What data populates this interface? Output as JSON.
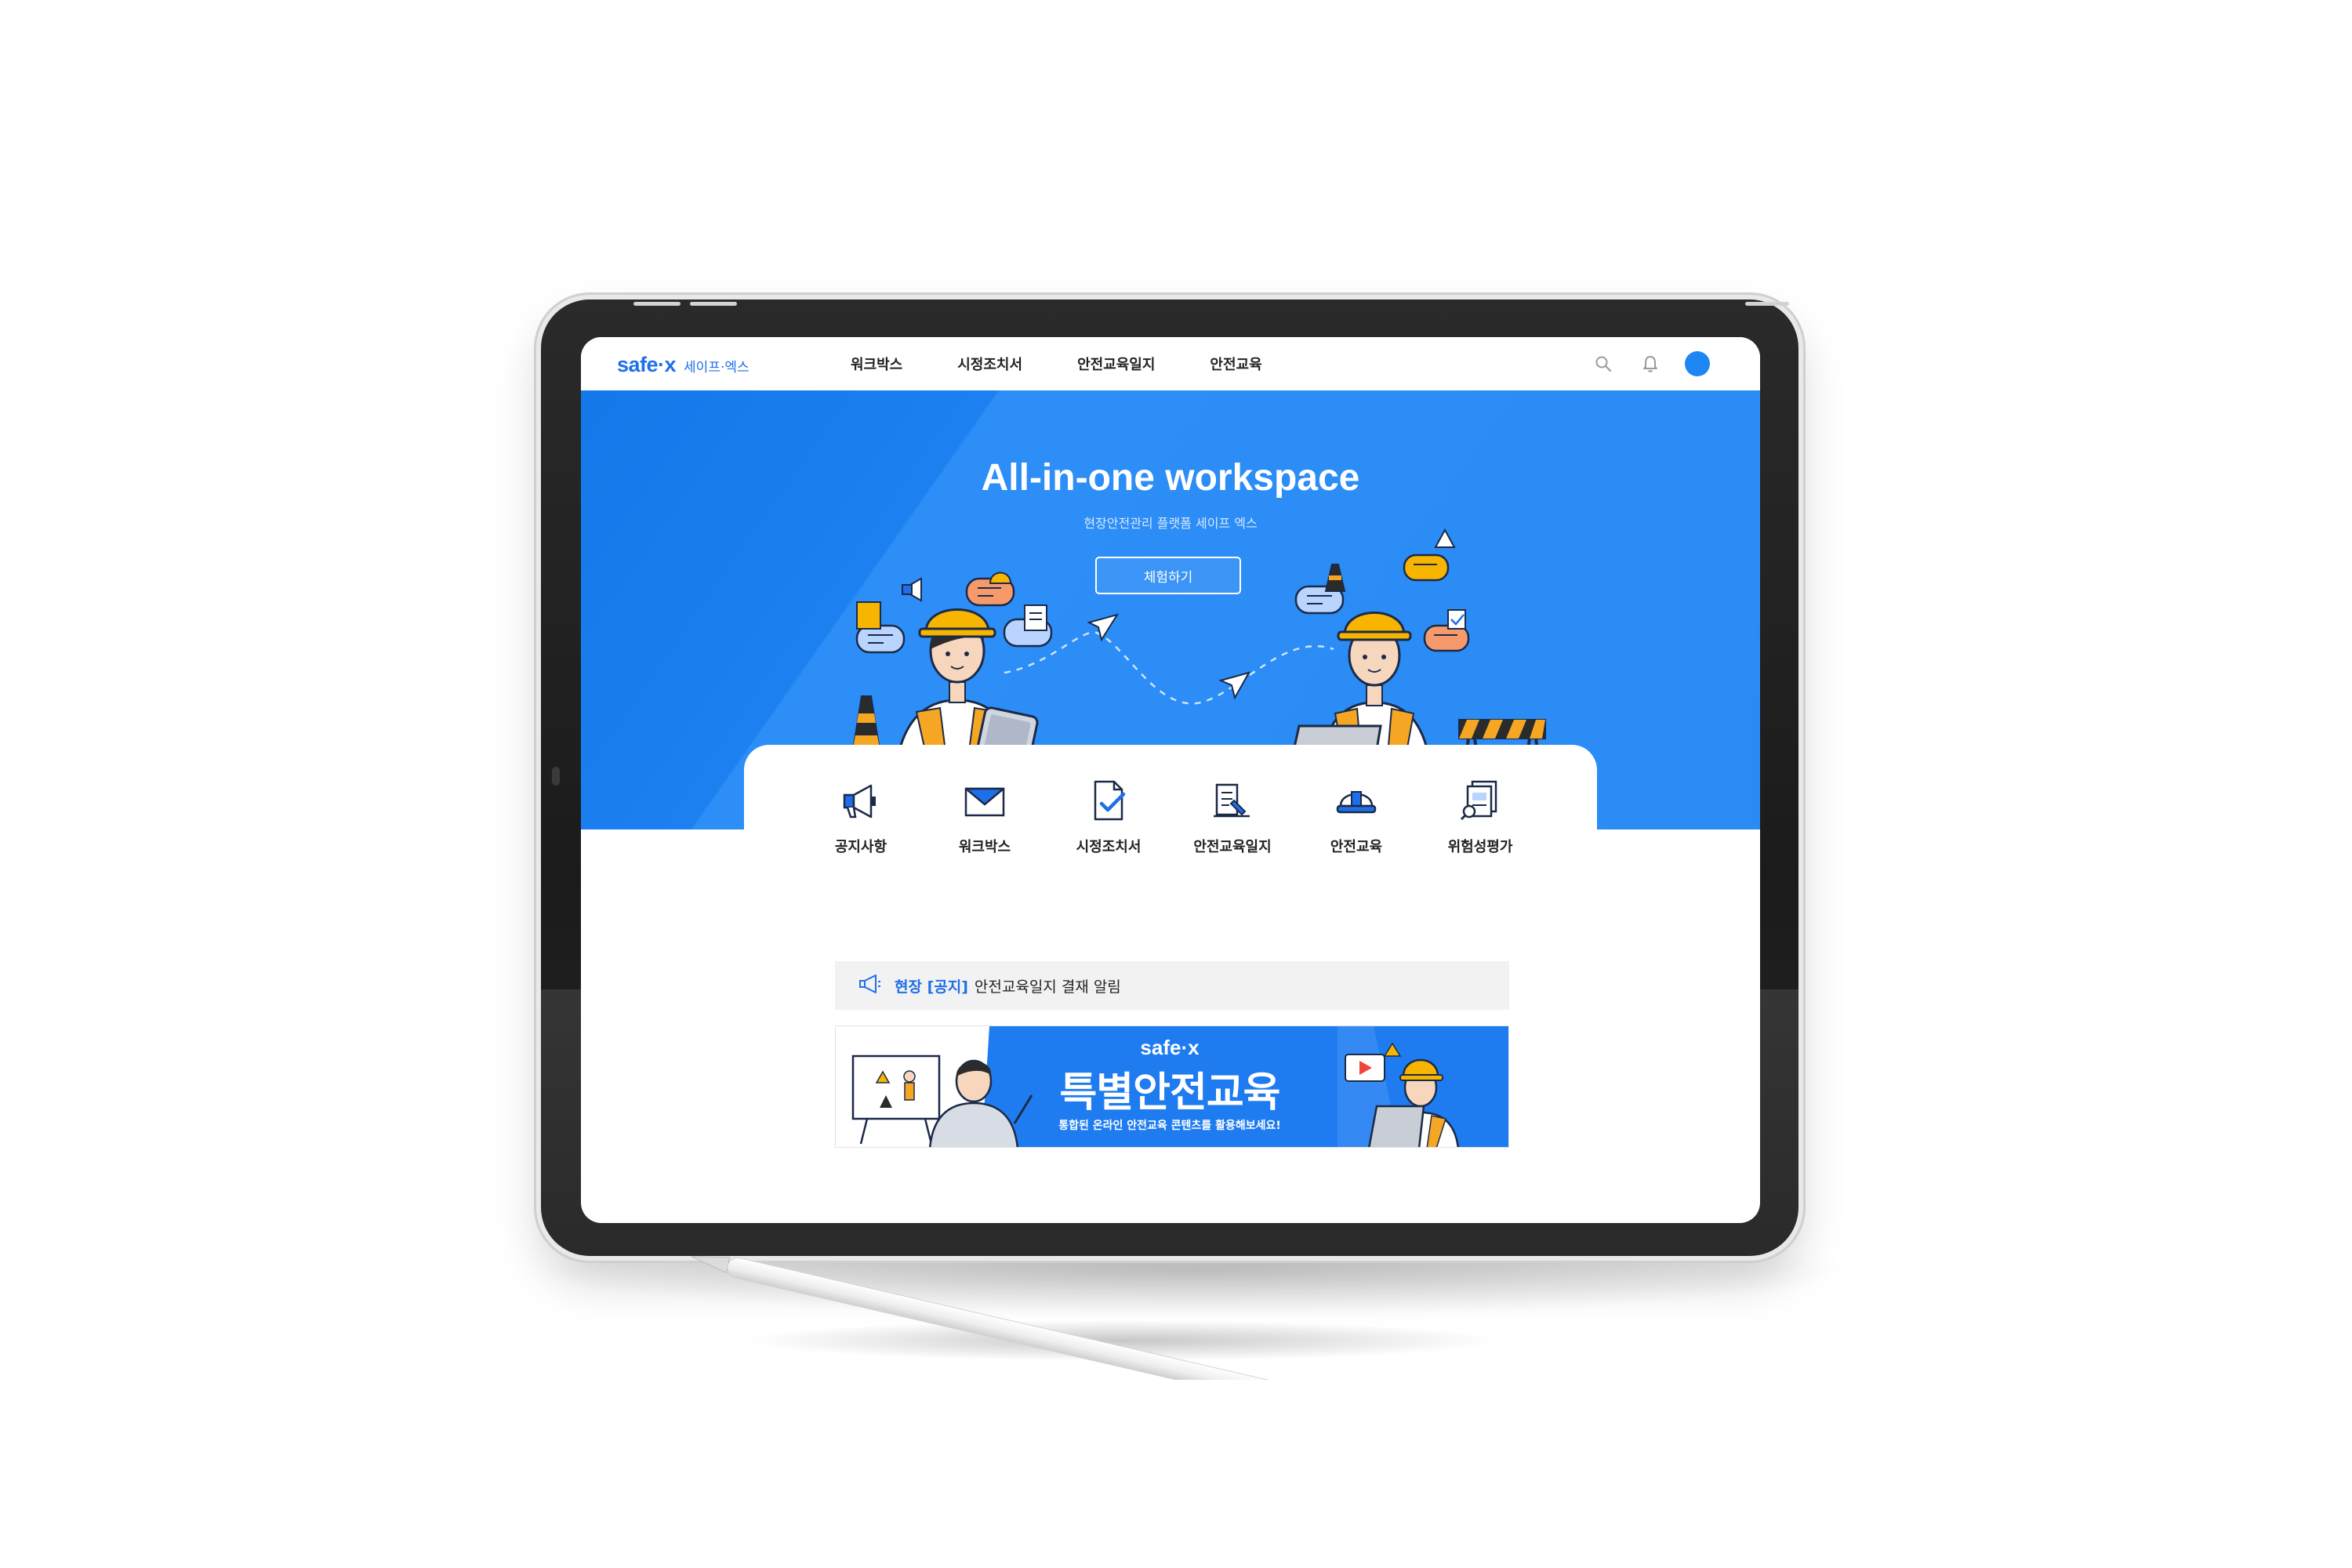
{
  "app": {
    "logo": "safe·x",
    "logo_sub": "세이프·엑스"
  },
  "header": {
    "nav": [
      "워크박스",
      "시정조치서",
      "안전교육일지",
      "안전교육"
    ]
  },
  "hero": {
    "title": "All-in-one workspace",
    "subtitle": "현장안전관리 플랫폼 세이프 엑스",
    "button": "체험하기"
  },
  "quick_menu": [
    {
      "label": "공지사항",
      "icon": "megaphone-icon"
    },
    {
      "label": "워크박스",
      "icon": "envelope-icon"
    },
    {
      "label": "시정조치서",
      "icon": "checked-document-icon"
    },
    {
      "label": "안전교육일지",
      "icon": "writing-document-icon"
    },
    {
      "label": "안전교육",
      "icon": "hard-hat-icon"
    },
    {
      "label": "위험성평가",
      "icon": "report-search-icon"
    }
  ],
  "notice": {
    "tag": "현장 [공지]",
    "text": "안전교육일지 결재 알림"
  },
  "banner": {
    "logo": "safe·x",
    "title": "특별안전교육",
    "subtitle": "통합된 온라인 안전교육 콘텐츠를 활용해보세요!"
  },
  "colors": {
    "brand": "#1e6fe8",
    "hero_blue": "#2a8bf4",
    "vest": "#f5a623",
    "helmet": "#f7b500"
  }
}
